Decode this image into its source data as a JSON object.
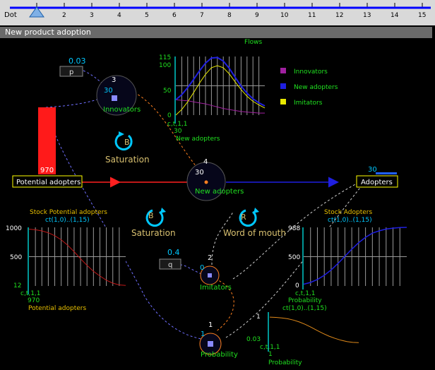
{
  "ruler": {
    "label": "Dot",
    "ticks": [
      "1",
      "2",
      "3",
      "4",
      "5",
      "6",
      "7",
      "8",
      "9",
      "10",
      "11",
      "12",
      "13",
      "14",
      "15"
    ],
    "current": "1"
  },
  "panel": {
    "title": "New product adoption"
  },
  "params": {
    "p": {
      "label": "p",
      "value": "0.03"
    },
    "q": {
      "label": "q",
      "value": "0.4"
    }
  },
  "nodes": {
    "innovators": {
      "number": "3",
      "value": "30",
      "label": "Innovators"
    },
    "new_adopters": {
      "number": "4",
      "value": "30",
      "label": "New adopters"
    },
    "imitators": {
      "number": "2",
      "value": "0",
      "label": "Imitators"
    },
    "probability": {
      "number": "1",
      "value": "1",
      "label": "Probability"
    }
  },
  "stocks": {
    "potential": {
      "label": "Potential adopters",
      "value": "970"
    },
    "adopters": {
      "label": "Adopters",
      "value": "30"
    }
  },
  "loops": {
    "saturation_top": {
      "letter": "B",
      "label": "Saturation"
    },
    "saturation_bottom": {
      "letter": "B",
      "label": "Saturation"
    },
    "word_of_mouth": {
      "letter": "R",
      "label": "Word of mouth"
    }
  },
  "charts": {
    "flows": {
      "title": "Flows",
      "ticks_y": [
        "115",
        "100",
        "50",
        "0"
      ],
      "x_label_1": "c,t,1,1",
      "x_label_2": "30",
      "x_caption": "New adopters",
      "legend": [
        {
          "label": "Innovators",
          "color": "#a020a0"
        },
        {
          "label": "New adopters",
          "color": "#1f1fe0"
        },
        {
          "label": "Imitators",
          "color": "#e8e800"
        }
      ]
    },
    "potential": {
      "title_1": "Stock Potential adopters",
      "title_2": "ct(1,0)..(1,15)",
      "ticks_y": [
        "1000",
        "500",
        "12"
      ],
      "x_label_1": "c,t,1,1",
      "x_label_2": "970",
      "x_caption": "Potential adopters"
    },
    "adopters": {
      "title_1": "Stock Adopters",
      "title_2": "ct(1,0)..(1,15)",
      "ticks_y": [
        "988",
        "500",
        "0"
      ],
      "x_label_1": "c,t,1,1",
      "x_label_2": "Probability",
      "x_caption": "ct(1,0)..(1,15)"
    },
    "probability": {
      "tick_top": "1",
      "tick_bottom": "0.03",
      "x_label_1": "c,t,1,1",
      "x_label_2": "1",
      "x_caption": "Probability"
    }
  },
  "chart_data": [
    {
      "type": "line",
      "title": "Flows",
      "x": [
        0,
        1,
        2,
        3,
        4,
        5,
        6,
        7,
        8,
        9,
        10,
        11,
        12,
        13,
        14,
        15
      ],
      "ylim": [
        0,
        115
      ],
      "series": [
        {
          "name": "Innovators",
          "values": [
            30,
            29,
            28,
            26,
            24,
            22,
            19,
            16,
            13,
            11,
            9,
            7,
            6,
            5,
            4,
            4
          ]
        },
        {
          "name": "New adopters",
          "values": [
            30,
            40,
            54,
            70,
            87,
            102,
            112,
            113,
            106,
            92,
            74,
            57,
            43,
            32,
            24,
            18
          ]
        },
        {
          "name": "Imitators",
          "values": [
            0,
            11,
            26,
            44,
            63,
            80,
            93,
            97,
            93,
            81,
            65,
            50,
            37,
            27,
            20,
            14
          ]
        }
      ]
    },
    {
      "type": "line",
      "title": "Stock Potential adopters",
      "x": [
        0,
        1,
        2,
        3,
        4,
        5,
        6,
        7,
        8,
        9,
        10,
        11,
        12,
        13,
        14,
        15
      ],
      "ylim": [
        12,
        1000
      ],
      "series": [
        {
          "name": "Potential adopters",
          "values": [
            970,
            960,
            940,
            910,
            860,
            790,
            700,
            590,
            470,
            360,
            260,
            180,
            110,
            60,
            30,
            20
          ]
        }
      ]
    },
    {
      "type": "line",
      "title": "Stock Adopters",
      "x": [
        0,
        1,
        2,
        3,
        4,
        5,
        6,
        7,
        8,
        9,
        10,
        11,
        12,
        13,
        14,
        15
      ],
      "ylim": [
        0,
        988
      ],
      "series": [
        {
          "name": "Adopters",
          "values": [
            30,
            60,
            110,
            180,
            270,
            380,
            500,
            620,
            730,
            820,
            890,
            930,
            960,
            975,
            985,
            988
          ]
        }
      ]
    },
    {
      "type": "line",
      "title": "Probability",
      "x": [
        0,
        1,
        2,
        3,
        4,
        5,
        6,
        7,
        8,
        9,
        10,
        11,
        12,
        13,
        14,
        15
      ],
      "ylim": [
        0,
        1
      ],
      "series": [
        {
          "name": "Probability",
          "values": [
            0.97,
            0.96,
            0.94,
            0.91,
            0.86,
            0.79,
            0.7,
            0.59,
            0.47,
            0.36,
            0.26,
            0.18,
            0.11,
            0.06,
            0.03,
            0.02
          ]
        }
      ]
    }
  ]
}
